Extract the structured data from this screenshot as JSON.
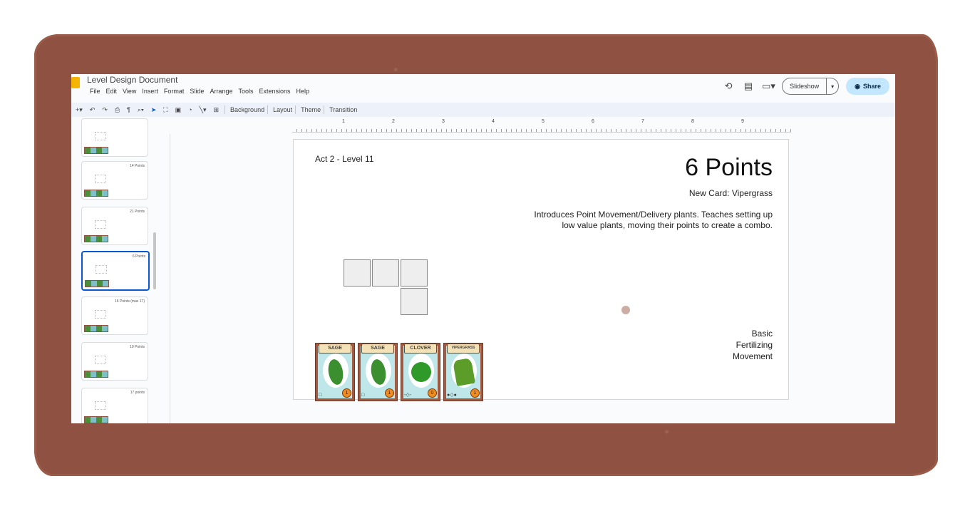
{
  "app": {
    "doc_title": "Level Design Document",
    "menu": [
      "File",
      "Edit",
      "View",
      "Insert",
      "Format",
      "Slide",
      "Arrange",
      "Tools",
      "Extensions",
      "Help"
    ],
    "slideshow_label": "Slideshow",
    "share_label": "Share"
  },
  "toolbar": {
    "background_label": "Background",
    "layout_label": "Layout",
    "theme_label": "Theme",
    "transition_label": "Transition"
  },
  "ruler": {
    "ticks": [
      "1",
      "2",
      "3",
      "4",
      "5",
      "6",
      "7",
      "8",
      "9"
    ]
  },
  "filmstrip": [
    {
      "title": ""
    },
    {
      "title": "14 Points"
    },
    {
      "title": "21 Points"
    },
    {
      "title": "6 Points",
      "selected": true
    },
    {
      "title": "16 Points (max 17)"
    },
    {
      "title": "10 Points"
    },
    {
      "title": "17 points"
    }
  ],
  "slide": {
    "level": "Act 2 - Level 11",
    "points": "6 Points",
    "new_card": "New Card: Vipergrass",
    "description": "Introduces Point Movement/Delivery plants. Teaches setting up low value plants, moving their points to create a combo.",
    "tags": [
      "Basic",
      "Fertilizing",
      "Movement"
    ],
    "cards": [
      {
        "name": "SAGE",
        "value": "1"
      },
      {
        "name": "SAGE",
        "value": "1"
      },
      {
        "name": "CLOVER",
        "value": "0"
      },
      {
        "name": "VIPERGRASS",
        "value": "1"
      }
    ]
  }
}
